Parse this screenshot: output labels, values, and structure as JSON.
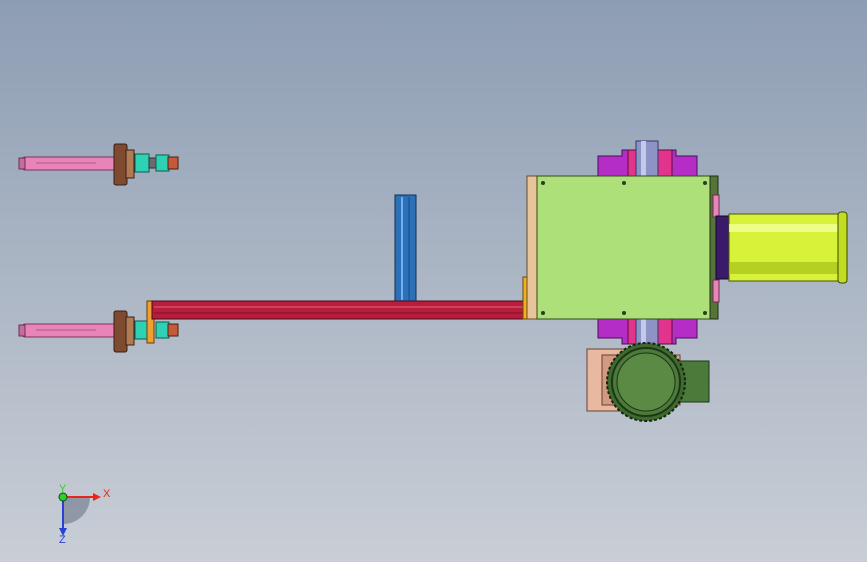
{
  "axis_triad": {
    "x_label": "X",
    "y_label": "Y",
    "z_label": "Z",
    "x_color": "#e8261c",
    "y_color": "#2bd12b",
    "z_color": "#2a3fd6"
  },
  "colors": {
    "background_top": "#8d9db4",
    "background_bottom": "#c9ced6",
    "main_housing": "#aee07a",
    "yellow_cylinder": "#d8f23a",
    "motor": "#4b7a3a",
    "purple_bracket": "#b42dc7",
    "red_bar": "#b81e3c",
    "blue_post": "#2c71b8",
    "pink_shaft": "#e884b8",
    "teal_nut": "#2fd1b4"
  },
  "parts": [
    "shaft-assembly-top",
    "shaft-assembly-bottom",
    "main-housing",
    "cylinder-actuator",
    "gear-motor",
    "linear-rail",
    "vertical-post"
  ]
}
